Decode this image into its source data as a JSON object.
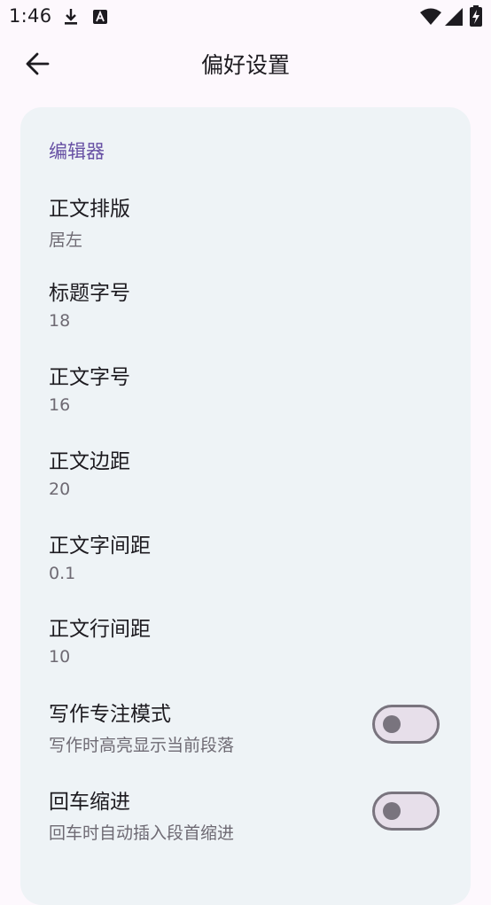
{
  "status_bar": {
    "time": "1:46",
    "icons": [
      "download-icon",
      "notification-a-icon",
      "wifi-icon",
      "signal-icon",
      "battery-charging-icon"
    ]
  },
  "app_bar": {
    "back_icon": "arrow-left-icon",
    "title": "偏好设置"
  },
  "section": {
    "title": "编辑器"
  },
  "preferences": [
    {
      "title": "正文排版",
      "summary": "居左"
    },
    {
      "title": "标题字号",
      "summary": "18"
    },
    {
      "title": "正文字号",
      "summary": "16"
    },
    {
      "title": "正文边距",
      "summary": "20"
    },
    {
      "title": "正文字间距",
      "summary": "0.1"
    },
    {
      "title": "正文行间距",
      "summary": "10"
    }
  ],
  "switches": [
    {
      "title": "写作专注模式",
      "summary": "写作时高亮显示当前段落",
      "checked": false
    },
    {
      "title": "回车缩进",
      "summary": "回车时自动插入段首缩进",
      "checked": false
    }
  ],
  "colors": {
    "background": "#fdf8fd",
    "card": "#eef3f6",
    "accent": "#6750a4",
    "switch_outline": "#79747e",
    "switch_track": "#e7dfea"
  }
}
